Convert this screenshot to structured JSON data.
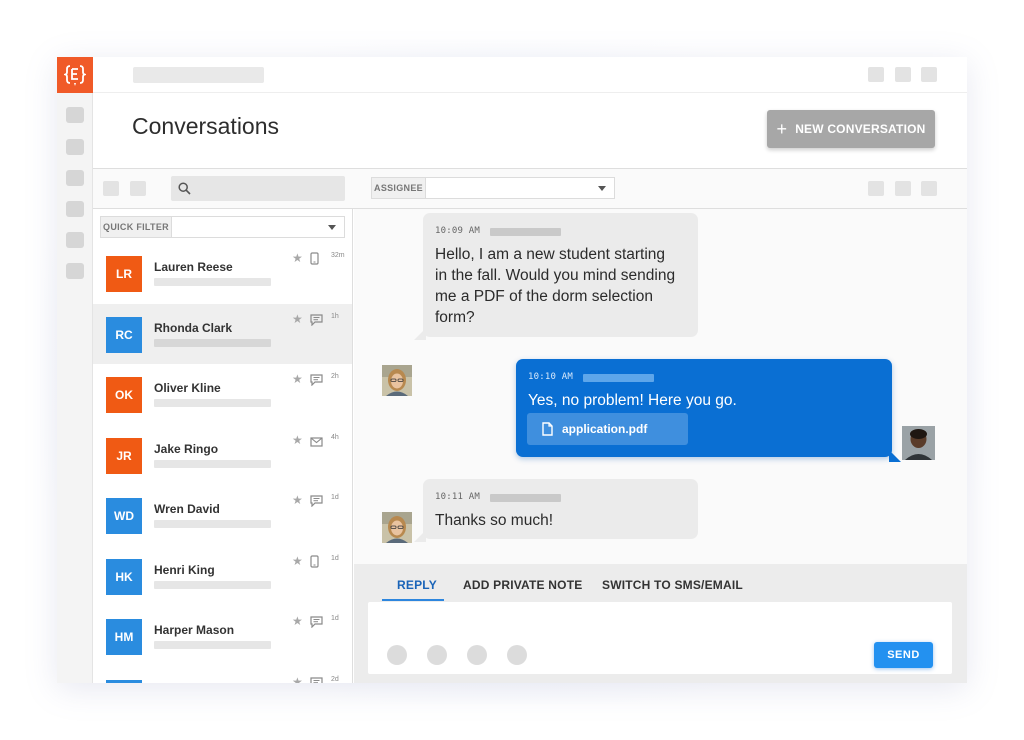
{
  "header": {
    "title": "Conversations",
    "new_button_label": "NEW CONVERSATION"
  },
  "filters": {
    "assignee_label": "ASSIGNEE",
    "quick_filter_label": "QUICK FILTER"
  },
  "conversations": [
    {
      "initials": "LR",
      "name": "Lauren Reese",
      "time": "32m",
      "channel": "phone-icon",
      "color": "#f05a14"
    },
    {
      "initials": "RC",
      "name": "Rhonda Clark",
      "time": "1h",
      "channel": "chat-icon",
      "color": "#2a8cdf",
      "active": true
    },
    {
      "initials": "OK",
      "name": "Oliver Kline",
      "time": "2h",
      "channel": "chat-icon",
      "color": "#f05a14"
    },
    {
      "initials": "JR",
      "name": "Jake Ringo",
      "time": "4h",
      "channel": "mail-icon",
      "color": "#f05a14"
    },
    {
      "initials": "WD",
      "name": "Wren David",
      "time": "1d",
      "channel": "chat-icon",
      "color": "#2a8cdf"
    },
    {
      "initials": "HK",
      "name": "Henri King",
      "time": "1d",
      "channel": "phone-icon",
      "color": "#2a8cdf"
    },
    {
      "initials": "HM",
      "name": "Harper Mason",
      "time": "1d",
      "channel": "chat-icon",
      "color": "#2a8cdf"
    },
    {
      "initials": "",
      "name": "",
      "time": "2d",
      "channel": "chat-icon",
      "color": "#2a8cdf"
    }
  ],
  "messages": [
    {
      "time": "10:09 AM",
      "text": "Hello, I am a new student starting in the fall. Would you mind sending me a PDF of the dorm selection form?",
      "lines": [
        "Hello, I am a new student starting",
        "in the fall. Would you mind sending",
        "me a PDF of the dorm selection",
        "form?"
      ]
    },
    {
      "time": "10:10 AM",
      "text": "Yes, no problem! Here you go.",
      "attachment": "application.pdf"
    },
    {
      "time": "10:11 AM",
      "text": "Thanks so much!"
    }
  ],
  "composer": {
    "tabs": [
      "REPLY",
      "ADD PRIVATE NOTE",
      "SWITCH TO SMS/EMAIL"
    ],
    "active_tab": "REPLY",
    "send_label": "SEND"
  },
  "colors": {
    "brand": "#f05a28",
    "outgoing": "#0a6fd3",
    "send": "#2391f0",
    "new_button": "#a7a7a7"
  }
}
